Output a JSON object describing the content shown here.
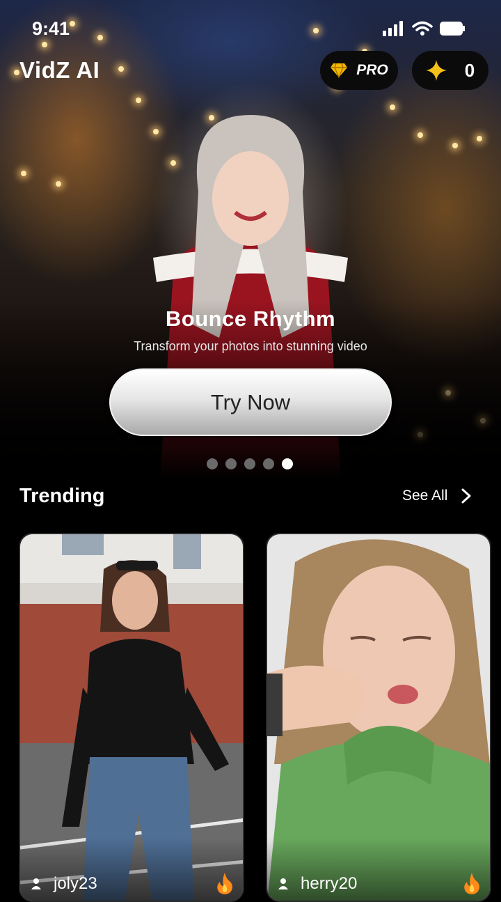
{
  "status_bar": {
    "time": "9:41"
  },
  "header": {
    "app_title": "VidZ AI",
    "pro_label": "PRO",
    "credits": "0"
  },
  "hero": {
    "title": "Bounce Rhythm",
    "subtitle": "Transform your photos into stunning video",
    "cta_label": "Try Now",
    "slide_count": 5,
    "active_slide": 5
  },
  "trending": {
    "title": "Trending",
    "see_all_label": "See All",
    "cards": [
      {
        "username": "joly23"
      },
      {
        "username": "herry20"
      }
    ]
  },
  "colors": {
    "background": "#000000",
    "gem": "#f5b800",
    "sparkle": "#f5c018",
    "fire": "#ff8a1a"
  },
  "icons": [
    "signal-icon",
    "wifi-icon",
    "battery-icon",
    "gem-icon",
    "sparkle-icon",
    "chevron-right-icon",
    "user-icon",
    "fire-icon"
  ]
}
